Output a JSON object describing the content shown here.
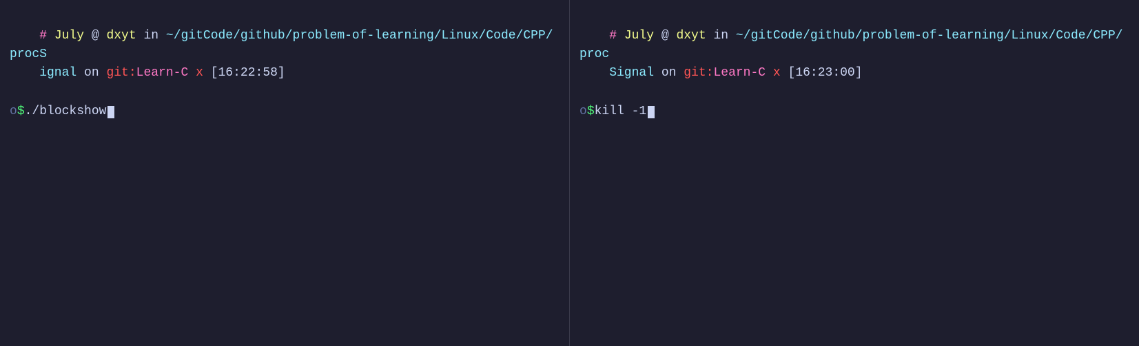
{
  "pane1": {
    "line1": {
      "hash": "# ",
      "user": "July",
      "at": " @ ",
      "host": "dxyt",
      "in": " in ",
      "path": "~/gitCode/github/problem-of-learning/Linux/Code/CPP/procSignal",
      "on": " on ",
      "git": "git:",
      "branch": "Learn-C",
      "space": " ",
      "x": "x",
      "time": " [16:22:58]"
    },
    "line2": {
      "circle": "o",
      "dollar": " $ ",
      "command": "./blockshow",
      "cursor": true
    }
  },
  "pane2": {
    "line1": {
      "hash": "# ",
      "user": "July",
      "at": " @ ",
      "host": "dxyt",
      "in": " in ",
      "path": "~/gitCode/github/problem-of-learning/Linux/Code/CPP/procSignal",
      "on": " on ",
      "git": "git:",
      "branch": "Learn-C",
      "space": " ",
      "x": "x",
      "time": " [16:23:00]"
    },
    "line2": {
      "circle": "o",
      "dollar": " $ ",
      "command": "kill -1",
      "cursor": true
    }
  }
}
